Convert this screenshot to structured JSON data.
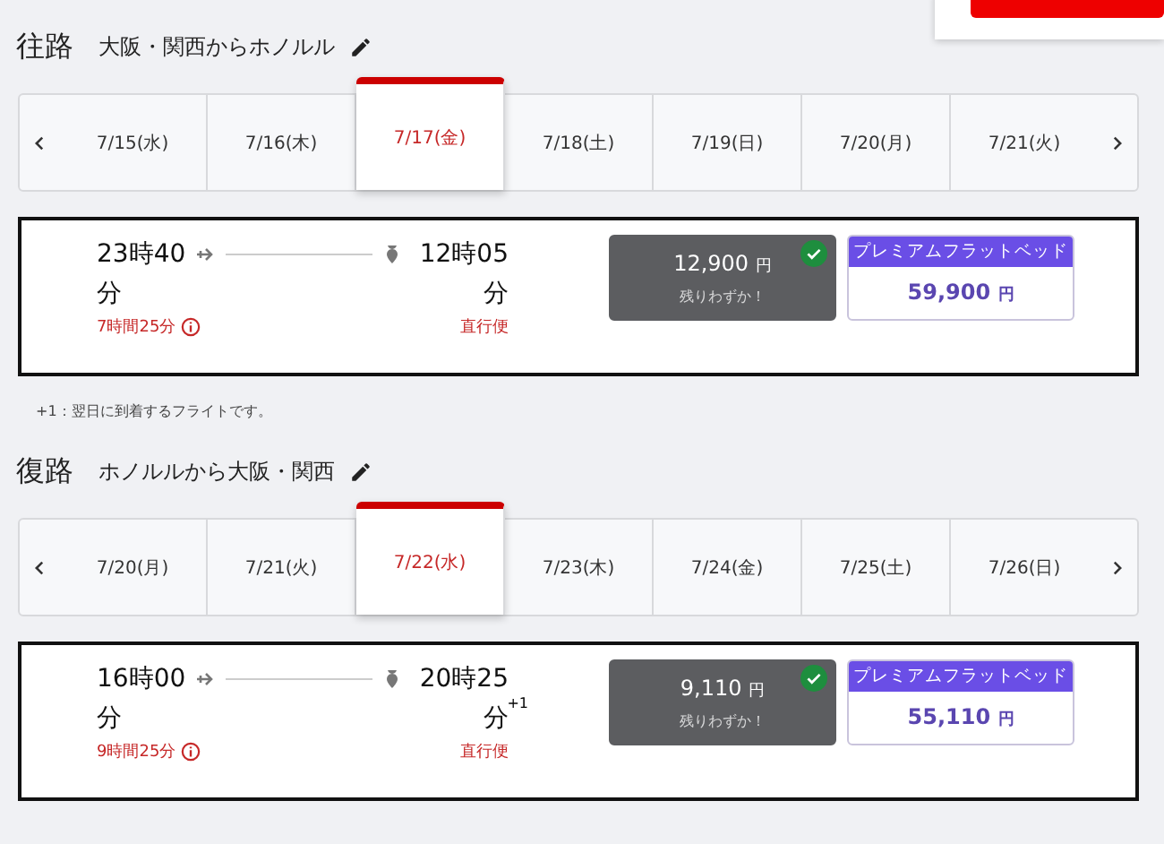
{
  "legs": [
    {
      "direction": "往路",
      "route": "大阪・関西からホノルル",
      "dates": [
        {
          "label": "7/15(水)",
          "selected": false
        },
        {
          "label": "7/16(木)",
          "selected": false
        },
        {
          "label": "7/17(金)",
          "selected": true
        },
        {
          "label": "7/18(土)",
          "selected": false
        },
        {
          "label": "7/19(日)",
          "selected": false
        },
        {
          "label": "7/20(月)",
          "selected": false
        },
        {
          "label": "7/21(火)",
          "selected": false
        }
      ],
      "flight": {
        "depart": "23時40分",
        "arrive": "12時05分",
        "duration": "7時間25分",
        "type": "直行便",
        "fares": [
          {
            "kind": "standard",
            "price": "12,900",
            "currency": "円",
            "note": "残りわずか！",
            "selected": true
          },
          {
            "kind": "premium",
            "label": "プレミアムフラットベッド",
            "price": "59,900",
            "currency": "円",
            "selected": false
          }
        ]
      },
      "footnote": "+1：翌日に到着するフライトです。"
    },
    {
      "direction": "復路",
      "route": "ホノルルから大阪・関西",
      "dates": [
        {
          "label": "7/20(月)",
          "selected": false
        },
        {
          "label": "7/21(火)",
          "selected": false
        },
        {
          "label": "7/22(水)",
          "selected": true
        },
        {
          "label": "7/23(木)",
          "selected": false
        },
        {
          "label": "7/24(金)",
          "selected": false
        },
        {
          "label": "7/25(土)",
          "selected": false
        },
        {
          "label": "7/26(日)",
          "selected": false
        }
      ],
      "flight": {
        "depart": "16時00分",
        "arrive": "20時25分",
        "arrive_mark": "+1",
        "duration": "9時間25分",
        "type": "直行便",
        "fares": [
          {
            "kind": "standard",
            "price": "9,110",
            "currency": "円",
            "note": "残りわずか！",
            "selected": true
          },
          {
            "kind": "premium",
            "label": "プレミアムフラットベッド",
            "price": "55,110",
            "currency": "円",
            "selected": false
          }
        ]
      }
    }
  ]
}
